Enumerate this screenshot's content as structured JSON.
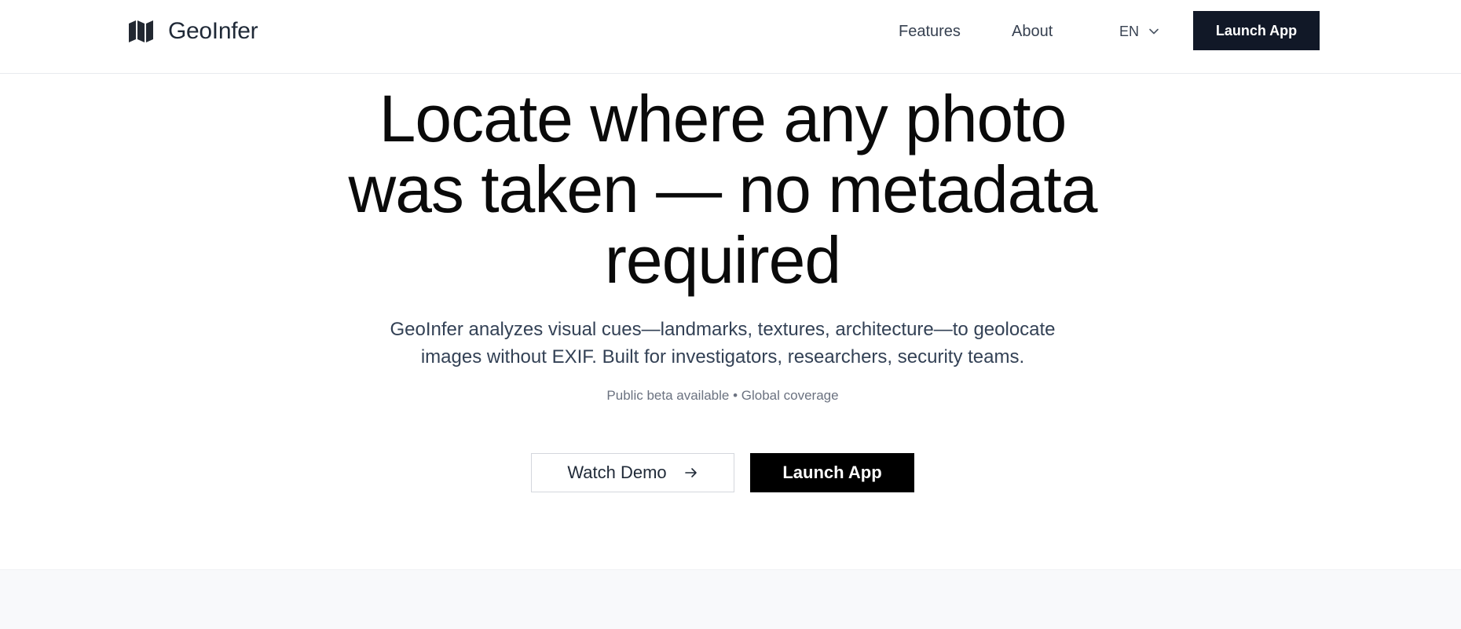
{
  "header": {
    "brand_name": "GeoInfer",
    "brand_icon": "map-icon",
    "nav": {
      "features": "Features",
      "about": "About"
    },
    "language": {
      "selected": "EN",
      "icon": "chevron-down-icon"
    },
    "cta_label": "Launch App"
  },
  "hero": {
    "title_line1": "Locate where any photo",
    "title_line2": "was taken — no metadata",
    "title_line3": "required",
    "subtitle_line1": "GeoInfer analyzes visual cues—landmarks, textures, architecture—to geolocate",
    "subtitle_line2": "images without EXIF. Built for investigators, researchers, security teams.",
    "note": "Public beta available • Global coverage",
    "demo_label": "Watch Demo",
    "demo_icon": "arrow-right-icon",
    "launch_label": "Launch App"
  },
  "colors": {
    "primary_dark": "#111827",
    "black": "#000000",
    "text_muted": "#6b7280",
    "subtitle": "#334155",
    "section_bg": "#f8f9fb"
  }
}
